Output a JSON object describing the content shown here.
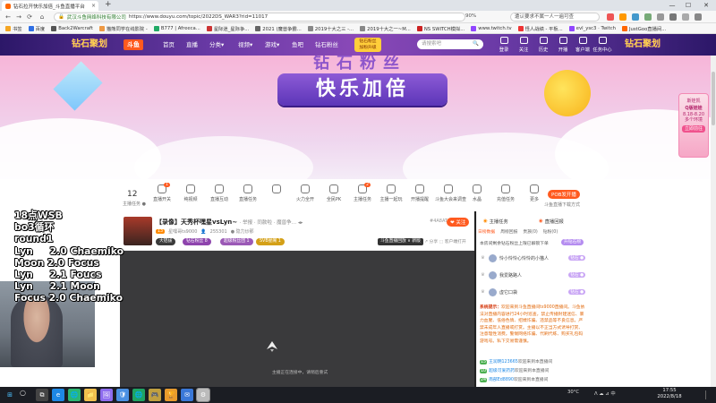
{
  "browser": {
    "tab_title": "钻石拉开快乐加倍_斗鱼直播平台",
    "tab_close": "×",
    "new_tab": "+",
    "win_controls": [
      "—",
      "☐",
      "✕"
    ],
    "nav": [
      "←",
      "→",
      "⟳",
      "⌂"
    ],
    "url_host": "武汉斗鱼网络科技有限公司",
    "url": "https://www.douyu.com/topic/2022DS_WAR3?rid=11017",
    "zoom": "90%",
    "search_text": "遭认要求不属一人一遍可查"
  },
  "bookmarks": [
    {
      "label": "书签",
      "color": "#f5a623"
    },
    {
      "label": "百度",
      "color": "#2f6fe4"
    },
    {
      "label": "Back2Warcraft",
      "color": "#555"
    },
    {
      "label": "猫熊同学在线影院 -",
      "color": "#e94"
    },
    {
      "label": "B777 | Afreeca...",
      "color": "#2a6"
    },
    {
      "label": "星际迷_星际争...",
      "color": "#c33"
    },
    {
      "label": "2021 (魔兽争霸...",
      "color": "#666"
    },
    {
      "label": "2019十大之三 -...",
      "color": "#888"
    },
    {
      "label": "2019十大之一~M...",
      "color": "#888"
    },
    {
      "label": "NS SWITCH模拟...",
      "color": "#c22"
    },
    {
      "label": "www.twitch.tv",
      "color": "#9146ff"
    },
    {
      "label": "怪人战绩 - 平板...",
      "color": "#e33"
    },
    {
      "label": "evl_ysc3 · Twitch",
      "color": "#9146ff"
    },
    {
      "label": "JustGoo直播间...",
      "color": "#f60"
    }
  ],
  "site": {
    "logo_left": "钻石\n聚划",
    "brand_tag": "斗鱼",
    "nav_items": [
      "首页",
      "直播",
      "分类▾",
      "视频▾",
      "游戏▾",
      "鱼吧",
      "钻石粉丝"
    ],
    "fans_badge": "钻石粉丝\n加粉升级",
    "search_placeholder": "请搜索吧",
    "search_icon": "🔍",
    "right_nav": [
      "登录",
      "关注",
      "历史",
      "开播",
      "客户端",
      "下载",
      "任务中心"
    ],
    "logo_right": "钻石\n聚划"
  },
  "banner": {
    "big_text": "钻石粉丝",
    "main_text": "快乐加倍",
    "side_promo_line1": "斯娃凯",
    "side_promo_line2": "Q版娃娃",
    "side_promo_line3": "8.18-8.20\n多个环境",
    "side_promo_btn": "立即前往"
  },
  "toolbar": {
    "count": "12",
    "count_label": "主播任务 ●",
    "tools": [
      {
        "label": "直播开关",
        "badge": "1"
      },
      {
        "label": "纯视频",
        "badge": ""
      },
      {
        "label": "直播互动",
        "badge": ""
      },
      {
        "label": "直播任务",
        "badge": ""
      },
      {
        "label": "",
        "badge": ""
      },
      {
        "label": "火力全开",
        "badge": ""
      },
      {
        "label": "全民PK",
        "badge": ""
      },
      {
        "label": "主播任务",
        "badge": "2"
      },
      {
        "label": "主播一起玩",
        "badge": ""
      },
      {
        "label": "开播提醒",
        "badge": ""
      },
      {
        "label": "斗鱼大会来调查",
        "badge": ""
      },
      {
        "label": "水晶",
        "badge": ""
      },
      {
        "label": "充值任务",
        "badge": ""
      },
      {
        "label": "更多",
        "badge": ""
      }
    ],
    "po_btn": "POB发开播",
    "po_label": "斗鱼直播下载方式"
  },
  "room": {
    "title": "【录像】天秀杯嘿星vsLyn~",
    "title_tags": "· 举报  · 同款啦 · 魔兽争… ◂▸",
    "level": "13",
    "anchor": "星嘿哥ts9000",
    "viewers": "255301",
    "extra": "● 隐力炒那",
    "pills": [
      {
        "label": "大铝拔",
        "color": "#3a3a3a"
      },
      {
        "label": "钻石粉丝 8",
        "color": "#8e44ad"
      },
      {
        "label": "超级粉丝团 1",
        "color": "#9b59b6"
      },
      {
        "label": "SVB星阁 1",
        "color": "#d4a017"
      }
    ],
    "report": "#4A8AT",
    "follow": "❤ 关注",
    "replay": "斗鱼直播回放 ∨ 新版",
    "share": "↗ 分享   ⬚ 客户端打开",
    "player_status": "主播正在连接中，请稍后重试"
  },
  "chat": {
    "tab1": "主播任务",
    "tab2": "直播回报",
    "subtabs": [
      "日榜数据",
      "周榜回报",
      "贵族(0)",
      "钻粉(0)"
    ],
    "rank_line": "本房间剩余钻石粉丝上限已解锁下单",
    "rank_btn": "升钻石榜",
    "fans": [
      {
        "rank": "♛",
        "name": "怜小怜怜心怜怜的小猫人",
        "badge": "钻石 ●"
      },
      {
        "rank": "♛",
        "name": "我爱路路人",
        "badge": "钻石 ●"
      },
      {
        "rank": "♛",
        "name": "虚它口袋",
        "badge": "钻石 ●"
      }
    ],
    "sys_label": "系统提示：",
    "sys_msg": "欢迎来到斗鱼直播间ts9000直播间。斗鱼依法对直播内容进行24小时巡查，禁止传播封建迷信、暴力血腥、低俗色情、招嫖诈骗、违禁品等不良信息。严禁未成年人直播或打赏。主播以不正当方式诱导打赏、注意理性消费。警惕网络诈骗、代刷代练、购买礼包码游戏号。私下交易需谨慎。",
    "entries": [
      {
        "lv": "15",
        "name": "王润明123665",
        "msg": "欢迎来到本直播间"
      },
      {
        "lv": "10",
        "name": "超级可爱药药",
        "msg": "欢迎来到本直播间"
      },
      {
        "lv": "24",
        "name": "南部Ed8890",
        "msg": "欢迎来到本直播间"
      }
    ]
  },
  "overlay": {
    "text": "18点WSB\nbo3循环\nround1\nLyn     2.0 Chaemiko\nMoon 2.0 Focus\nLyn     2.1 Foucs\nLyn     2.1 Moon\nFocus 2.0 Chaemiko"
  },
  "taskbar": {
    "start": "⊞",
    "search": "○",
    "apps": [
      "⧉",
      "e",
      "🌐",
      "📁",
      "🖼",
      "🛡",
      "🌐",
      "🎮",
      "🏆",
      "✉",
      "⚙"
    ],
    "weather": "30°C",
    "tray": "ᐱ  ☁  ⊿  中",
    "time": "17:55",
    "date": "2022/8/18"
  }
}
